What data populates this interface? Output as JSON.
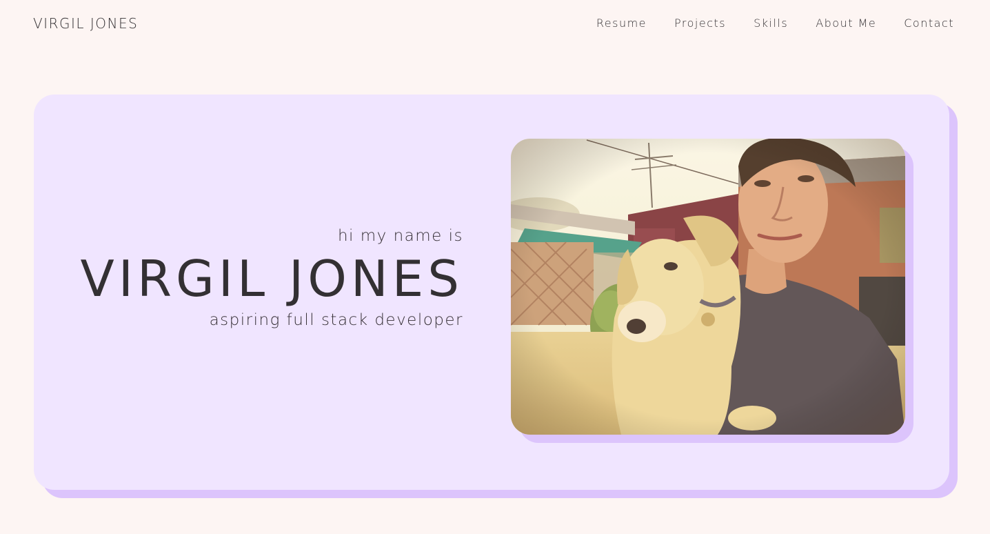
{
  "header": {
    "brand": "VIRGIL JONES",
    "nav": [
      {
        "label": "Resume"
      },
      {
        "label": "Projects"
      },
      {
        "label": "Skills"
      },
      {
        "label": "About Me"
      },
      {
        "label": "Contact"
      }
    ]
  },
  "hero": {
    "greeting": "hi my name is",
    "name": "VIRGIL JONES",
    "tagline": "aspiring full stack developer"
  },
  "colors": {
    "page_background": "#fdf5f3",
    "card_background": "#f0e5ff",
    "card_shadow": "#dcc4fc",
    "text": "#333033"
  }
}
